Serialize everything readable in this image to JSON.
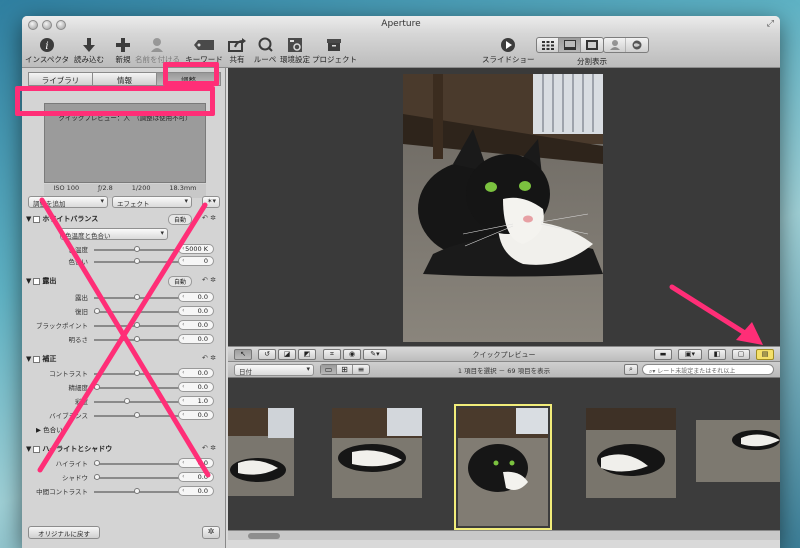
{
  "window": {
    "title": "Aperture"
  },
  "toolbar": {
    "buttons": [
      {
        "id": "inspector",
        "label": "インスペクタ",
        "icon": "info-icon"
      },
      {
        "id": "import",
        "label": "読み込む",
        "icon": "import-arrow-icon"
      },
      {
        "id": "new",
        "label": "新規",
        "icon": "plus-icon"
      },
      {
        "id": "name_face",
        "label": "名前を付ける",
        "icon": "person-icon",
        "disabled": true
      },
      {
        "id": "keyword",
        "label": "キーワード",
        "icon": "tag-icon"
      },
      {
        "id": "share",
        "label": "共有",
        "icon": "share-icon"
      },
      {
        "id": "loupe",
        "label": "ルーペ",
        "icon": "loupe-icon"
      },
      {
        "id": "preferences",
        "label": "環境設定",
        "icon": "preferences-icon"
      },
      {
        "id": "project",
        "label": "プロジェクト",
        "icon": "project-box-icon"
      }
    ],
    "slideshow_label": "スライドショー",
    "split_view_label": "分割表示"
  },
  "inspector": {
    "tabs": [
      "ライブラリ",
      "情報",
      "調整"
    ],
    "active_tab": "調整",
    "preview_message": "クイックプレビュー：入　（調整は使用不可）",
    "exif": {
      "iso": "ISO 100",
      "aperture": "ƒ/2.8",
      "shutter": "1/200",
      "focal": "18.3mm"
    },
    "add_adjustment": "調整を追加",
    "effects": "エフェクト",
    "sections": {
      "white_balance": {
        "title": "ホワイトバランス",
        "auto": "自動",
        "mode": "色温度と色合い",
        "rows": [
          {
            "label": "色温度",
            "value": "5000 K"
          },
          {
            "label": "色合い",
            "value": "0"
          }
        ]
      },
      "exposure": {
        "title": "露出",
        "auto": "自動",
        "rows": [
          {
            "label": "露出",
            "value": "0.0"
          },
          {
            "label": "復旧",
            "value": "0.0"
          },
          {
            "label": "ブラックポイント",
            "value": "0.0"
          },
          {
            "label": "明るさ",
            "value": "0.0"
          }
        ]
      },
      "enhance": {
        "title": "補正",
        "rows": [
          {
            "label": "コントラスト",
            "value": "0.0"
          },
          {
            "label": "精細度",
            "value": "0.0"
          },
          {
            "label": "彩度",
            "value": "1.0"
          },
          {
            "label": "バイブランス",
            "value": "0.0"
          }
        ],
        "tint_toggle": "色合い"
      },
      "highlights_shadows": {
        "title": "ハイライトとシャドウ",
        "rows": [
          {
            "label": "ハイライト",
            "value": "0.0"
          },
          {
            "label": "シャドウ",
            "value": "0.0"
          },
          {
            "label": "中間コントラスト",
            "value": "0.0"
          }
        ]
      }
    },
    "restore_button": "オリジナルに戻す"
  },
  "viewer_bar": {
    "mode_label": "クイックプレビュー"
  },
  "browser_bar": {
    "sort": "日付",
    "selection_status": "1 項目を選択 － 69 項目を表示",
    "search_placeholder": "レート未設定またはそれ以上"
  },
  "colors": {
    "annotation": "#ff2e77",
    "selection_outline": "#f2ed7a",
    "viewer_bg": "#3a3a3a"
  }
}
